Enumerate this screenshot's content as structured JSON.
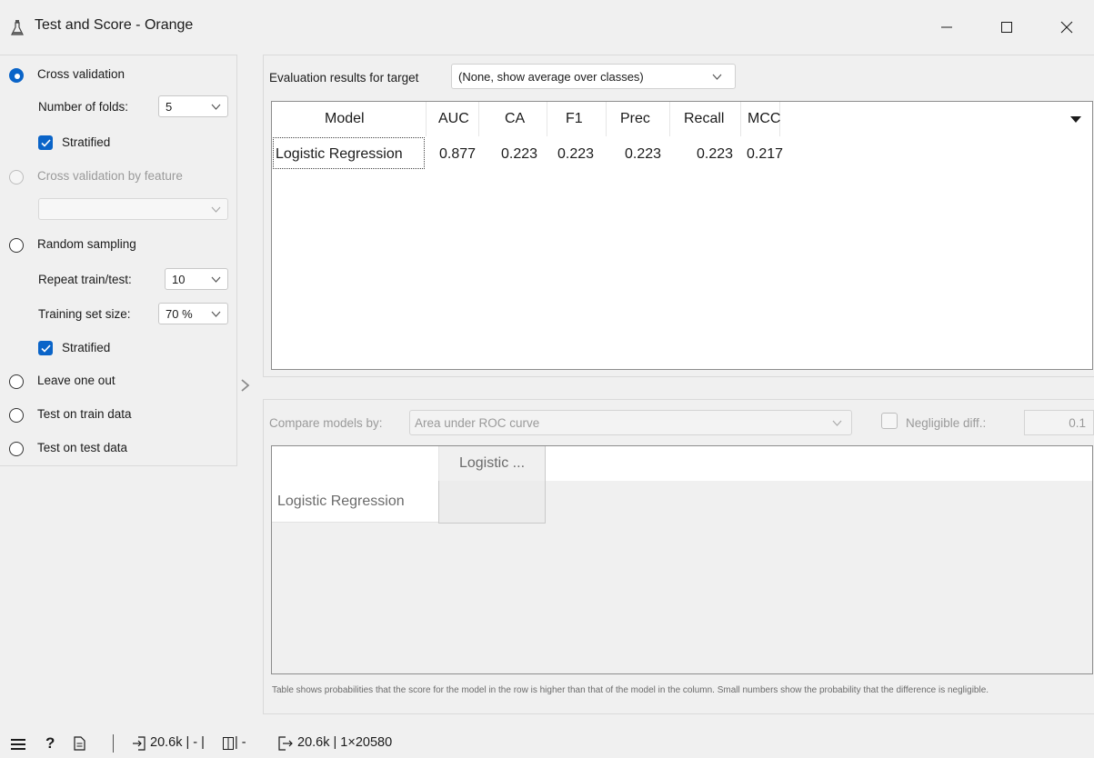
{
  "window": {
    "title": "Test and Score - Orange"
  },
  "sampling": {
    "cross_validation": {
      "label": "Cross validation",
      "selected": true
    },
    "folds_label": "Number of folds:",
    "folds_value": "5",
    "stratified_1": "Stratified",
    "cv_by_feature": {
      "label": "Cross validation by feature",
      "enabled": false
    },
    "random_sampling": {
      "label": "Random sampling",
      "selected": false
    },
    "repeat_label": "Repeat train/test:",
    "repeat_value": "10",
    "train_size_label": "Training set size:",
    "train_size_value": "70 %",
    "stratified_2": "Stratified",
    "leave_one_out": "Leave one out",
    "test_on_train": "Test on train data",
    "test_on_test": "Test on test data"
  },
  "evaluation": {
    "target_label": "Evaluation results for target",
    "target_value": "(None, show average over classes)",
    "columns": [
      "Model",
      "AUC",
      "CA",
      "F1",
      "Prec",
      "Recall",
      "MCC"
    ],
    "rows": [
      {
        "model": "Logistic Regression",
        "auc": "0.877",
        "ca": "0.223",
        "f1": "0.223",
        "prec": "0.223",
        "recall": "0.223",
        "mcc": "0.217"
      }
    ]
  },
  "comparison": {
    "compare_label": "Compare models by:",
    "compare_value": "Area under ROC curve",
    "negligible_label": "Negligible diff.:",
    "negligible_value": "0.1",
    "column_header": "Logistic ...",
    "row_header": "Logistic Regression",
    "footnote": "Table shows probabilities that the score for the model in the row is higher than that of the model in the column. Small numbers show the probability that the difference is negligible."
  },
  "statusbar": {
    "input_summary": "20.6k | - |",
    "input_summary_2": "| -",
    "output_summary": "20.6k | 1×20580"
  },
  "colors": {
    "accent": "#0a64c8",
    "background": "#f0f0f0"
  }
}
